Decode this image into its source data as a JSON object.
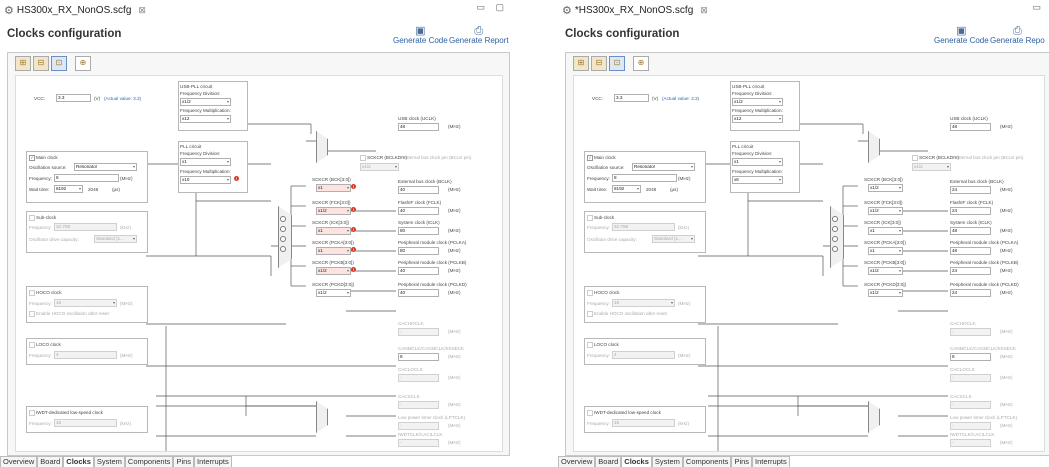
{
  "left": {
    "tab_title": "HS300x_RX_NonOS.scfg",
    "tab_close": "⊠",
    "window_controls": "▭ ▢",
    "page_title": "Clocks configuration",
    "generate_code": "Generate Code",
    "generate_report": "Generate Report",
    "toolbar": [
      "⊞",
      "⊟",
      "⊡",
      "⊕"
    ],
    "vcc": {
      "label": "VCC:",
      "value": "3.3",
      "unit": "(V)",
      "actual": "(Actual value: 3.3)"
    },
    "main_clock": {
      "checkbox": "Main clock",
      "osc_label": "Oscillation source:",
      "osc_value": "Resonator",
      "freq_label": "Frequency:",
      "freq_value": "8",
      "freq_unit": "(MHz)",
      "wait_label": "Wait time:",
      "wait_value": "8192",
      "wait_cycles": "2048",
      "wait_unit": "(μs)"
    },
    "sub_clock": {
      "checkbox": "Sub-clock",
      "freq_label": "Frequency:",
      "freq_value": "32.768",
      "freq_unit": "(kHz)",
      "drive_label": "Oscillator drive capacity:",
      "drive_value": "Standard (1..."
    },
    "hoco": {
      "checkbox": "HOCO clock",
      "freq_label": "Frequency:",
      "freq_value": "16",
      "freq_unit": "(MHz)",
      "enable": "Enable HOCO oscillation after reset"
    },
    "loco": {
      "checkbox": "LOCO clock",
      "freq_label": "Frequency:",
      "freq_value": "4",
      "freq_unit": "(MHz)"
    },
    "iwdt": {
      "checkbox": "IWDT-dedicated low-speed clock",
      "freq_label": "Frequency:",
      "freq_value": "15",
      "freq_unit": "(kHz)"
    },
    "usb_pll": {
      "title": "USB-PLL circuit",
      "div_label": "Frequency Division:",
      "div_value": "x1/2",
      "mul_label": "Frequency Multiplication:",
      "mul_value": "x12"
    },
    "pll": {
      "title": "PLL circuit",
      "div_label": "Frequency Division:",
      "div_value": "x1",
      "mul_label": "Frequency Multiplication:",
      "mul_value": "x10"
    },
    "dividers": [
      {
        "label": "SCKCR (BCK[3:0])",
        "value": "x1",
        "err": true
      },
      {
        "label": "SCKCR (FCK[3:0])",
        "value": "x1/2",
        "err": true
      },
      {
        "label": "SCKCR (ICK[3:0])",
        "value": "x1",
        "err": true
      },
      {
        "label": "SCKCR (PCKA[3:0])",
        "value": "x1",
        "err": true
      },
      {
        "label": "SCKCR (PCKB[3:0])",
        "value": "x1/2",
        "err": true
      },
      {
        "label": "SCKCR (PCKD[3:0])",
        "value": "x1/2",
        "err": false
      }
    ],
    "bclk": {
      "label": "SCKCR (BCLKDIV)",
      "value": "x1/2",
      "out_label": "External bus clock pin (BCLK pin)"
    },
    "outputs": [
      {
        "label": "USB clock (UCLK)",
        "value": "48",
        "unit": "(MHz)"
      },
      {
        "label": "External bus clock (BCLK)",
        "value": "40",
        "unit": "(MHz)"
      },
      {
        "label": "FlashIF clock (FCLK)",
        "value": "40",
        "unit": "(MHz)"
      },
      {
        "label": "System clock (ICLK)",
        "value": "80",
        "unit": "(MHz)"
      },
      {
        "label": "Peripheral module clock (PCLKA)",
        "value": "80",
        "unit": "(MHz)"
      },
      {
        "label": "Peripheral module clock (PCLKB)",
        "value": "40",
        "unit": "(MHz)"
      },
      {
        "label": "Peripheral module clock (PCLKD)",
        "value": "40",
        "unit": "(MHz)"
      }
    ],
    "misc": [
      {
        "label": "CACHOCLK",
        "value": "-",
        "unit": "(MHz)"
      },
      {
        "label": "CANMCLK/CACMCLK/SSSECK",
        "value": "8",
        "unit": "(MHz)"
      },
      {
        "label": "CACLOCLK",
        "value": "-",
        "unit": "(MHz)"
      },
      {
        "label": "CACSCLK",
        "value": "-",
        "unit": "(MHz)"
      },
      {
        "label": "Low power timer clock (LPTCLK)",
        "value": "-",
        "unit": "(MHz)"
      },
      {
        "label": "IWDTCLK/CACILCLK",
        "value": "-",
        "unit": "(MHz)"
      },
      {
        "label": "RTCSCLK",
        "value": "-",
        "unit": "(MHz)"
      }
    ],
    "bottom_tabs": [
      "Overview",
      "Board",
      "Clocks",
      "System",
      "Components",
      "Pins",
      "Interrupts"
    ],
    "active_tab": "Clocks"
  },
  "right": {
    "tab_title": "*HS300x_RX_NonOS.scfg",
    "tab_close": "⊠",
    "window_controls": "▭",
    "page_title": "Clocks configuration",
    "generate_code": "Generate Code",
    "generate_report": "Generate Repo",
    "toolbar": [
      "⊞",
      "⊟",
      "⊡",
      "⊕"
    ],
    "vcc": {
      "label": "VCC:",
      "value": "3.3",
      "unit": "(V)",
      "actual": "(Actual value: 3.3)"
    },
    "main_clock": {
      "checkbox": "Main clock",
      "osc_label": "Oscillation source:",
      "osc_value": "Resonator",
      "freq_label": "Frequency:",
      "freq_value": "8",
      "freq_unit": "(MHz)",
      "wait_label": "Wait time:",
      "wait_value": "8192",
      "wait_cycles": "2048",
      "wait_unit": "(μs)"
    },
    "sub_clock": {
      "checkbox": "Sub-clock",
      "freq_label": "Frequency:",
      "freq_value": "32.768",
      "freq_unit": "(kHz)",
      "drive_label": "Oscillator drive capacity:",
      "drive_value": "Standard (1..."
    },
    "hoco": {
      "checkbox": "HOCO clock",
      "freq_label": "Frequency:",
      "freq_value": "16",
      "freq_unit": "(MHz)",
      "enable": "Enable HOCO oscillation after reset"
    },
    "loco": {
      "checkbox": "LOCO clock",
      "freq_label": "Frequency:",
      "freq_value": "4",
      "freq_unit": "(MHz)"
    },
    "iwdt": {
      "checkbox": "IWDT-dedicated low-speed clock",
      "freq_label": "Frequency:",
      "freq_value": "15",
      "freq_unit": "(kHz)"
    },
    "usb_pll": {
      "title": "USB-PLL circuit",
      "div_label": "Frequency Division:",
      "div_value": "x1/2",
      "mul_label": "Frequency Multiplication:",
      "mul_value": "x12"
    },
    "pll": {
      "title": "PLL circuit",
      "div_label": "Frequency Division:",
      "div_value": "x1",
      "mul_label": "Frequency Multiplication:",
      "mul_value": "x6"
    },
    "dividers": [
      {
        "label": "SCKCR (BCK[3:0])",
        "value": "x1/2",
        "err": false
      },
      {
        "label": "SCKCR (FCK[3:0])",
        "value": "x1/2",
        "err": false
      },
      {
        "label": "SCKCR (ICK[3:0])",
        "value": "x1",
        "err": false
      },
      {
        "label": "SCKCR (PCKA[3:0])",
        "value": "x1",
        "err": false
      },
      {
        "label": "SCKCR (PCKB[3:0])",
        "value": "x1/2",
        "err": false
      },
      {
        "label": "SCKCR (PCKD[3:0])",
        "value": "x1/2",
        "err": false
      }
    ],
    "bclk": {
      "label": "SCKCR (BCLKDIV)",
      "value": "x1/2",
      "out_label": "External bus clock pin (BCLK pin)"
    },
    "outputs": [
      {
        "label": "USB clock (UCLK)",
        "value": "48",
        "unit": "(MHz)"
      },
      {
        "label": "External bus clock (BCLK)",
        "value": "24",
        "unit": "(MHz)"
      },
      {
        "label": "FlashIF clock (FCLK)",
        "value": "24",
        "unit": "(MHz)"
      },
      {
        "label": "System clock (ICLK)",
        "value": "48",
        "unit": "(MHz)"
      },
      {
        "label": "Peripheral module clock (PCLKA)",
        "value": "48",
        "unit": "(MHz)"
      },
      {
        "label": "Peripheral module clock (PCLKB)",
        "value": "24",
        "unit": "(MHz)"
      },
      {
        "label": "Peripheral module clock (PCLKD)",
        "value": "24",
        "unit": "(MHz)"
      }
    ],
    "misc": [
      {
        "label": "CACHOCLK",
        "value": "-",
        "unit": "(MHz)"
      },
      {
        "label": "CANMCLK/CACMCLK/SSSECK",
        "value": "8",
        "unit": "(MHz)"
      },
      {
        "label": "CACLOCLK",
        "value": "-",
        "unit": "(MHz)"
      },
      {
        "label": "CACSCLK",
        "value": "-",
        "unit": "(MHz)"
      },
      {
        "label": "Low power timer clock (LPTCLK)",
        "value": "-",
        "unit": "(MHz)"
      },
      {
        "label": "IWDTCLK/CACILCLK",
        "value": "-",
        "unit": "(MHz)"
      },
      {
        "label": "RTCSCLK",
        "value": "-",
        "unit": "(MHz)"
      }
    ],
    "bottom_tabs": [
      "Overview",
      "Board",
      "Clocks",
      "System",
      "Components",
      "Pins",
      "Interrupts"
    ],
    "active_tab": "Clocks"
  }
}
